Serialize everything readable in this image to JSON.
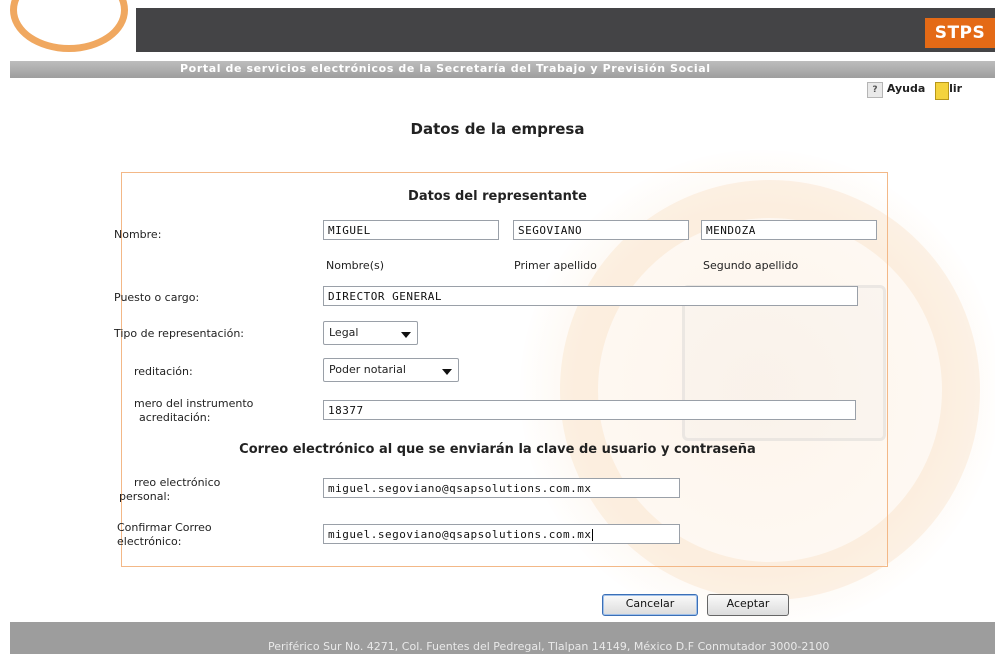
{
  "header": {
    "brand": "STPS",
    "portal_title": "Portal de servicios electrónicos de la Secretaría del Trabajo y Previsión Social",
    "help_label": "Ayuda",
    "exit_label": "lir"
  },
  "page_title": "Datos de la empresa",
  "representative": {
    "section_title": "Datos del representante",
    "name_label": "Nombre:",
    "first_name": "MIGUEL",
    "first_last_name": "SEGOVIANO",
    "second_last_name": "MENDOZA",
    "first_name_caption": "Nombre(s)",
    "first_last_name_caption": "Primer apellido",
    "second_last_name_caption": "Segundo apellido",
    "position_label": "Puesto o cargo:",
    "position_value": "DIRECTOR GENERAL",
    "rep_type_label": "Tipo de representación:",
    "rep_type_value": "Legal",
    "accreditation_label": "reditación:",
    "accreditation_value": "Poder notarial",
    "instrument_label_line1": "mero del instrumento",
    "instrument_label_line2": "acreditación:",
    "instrument_value": "18377"
  },
  "email": {
    "section_title": "Correo electrónico al que se enviarán la clave de usuario y contraseña",
    "personal_label_line1": "rreo electrónico",
    "personal_label_line2": "personal:",
    "personal_value": "miguel.segoviano@qsapsolutions.com.mx",
    "confirm_label_line1": "Confirmar Correo",
    "confirm_label_line2": "electrónico:",
    "confirm_value": "miguel.segoviano@qsapsolutions.com.mx"
  },
  "buttons": {
    "cancel": "Cancelar",
    "accept": "Aceptar"
  },
  "footer": {
    "text": "Periférico Sur No. 4271, Col. Fuentes del Pedregal, Tlalpan 14149, México D.F Conmutador 3000-2100"
  },
  "colors": {
    "brand_orange": "#e46a16",
    "header_dark": "#444446",
    "footer_gray": "#9d9d9d",
    "form_border": "#f3b887"
  }
}
